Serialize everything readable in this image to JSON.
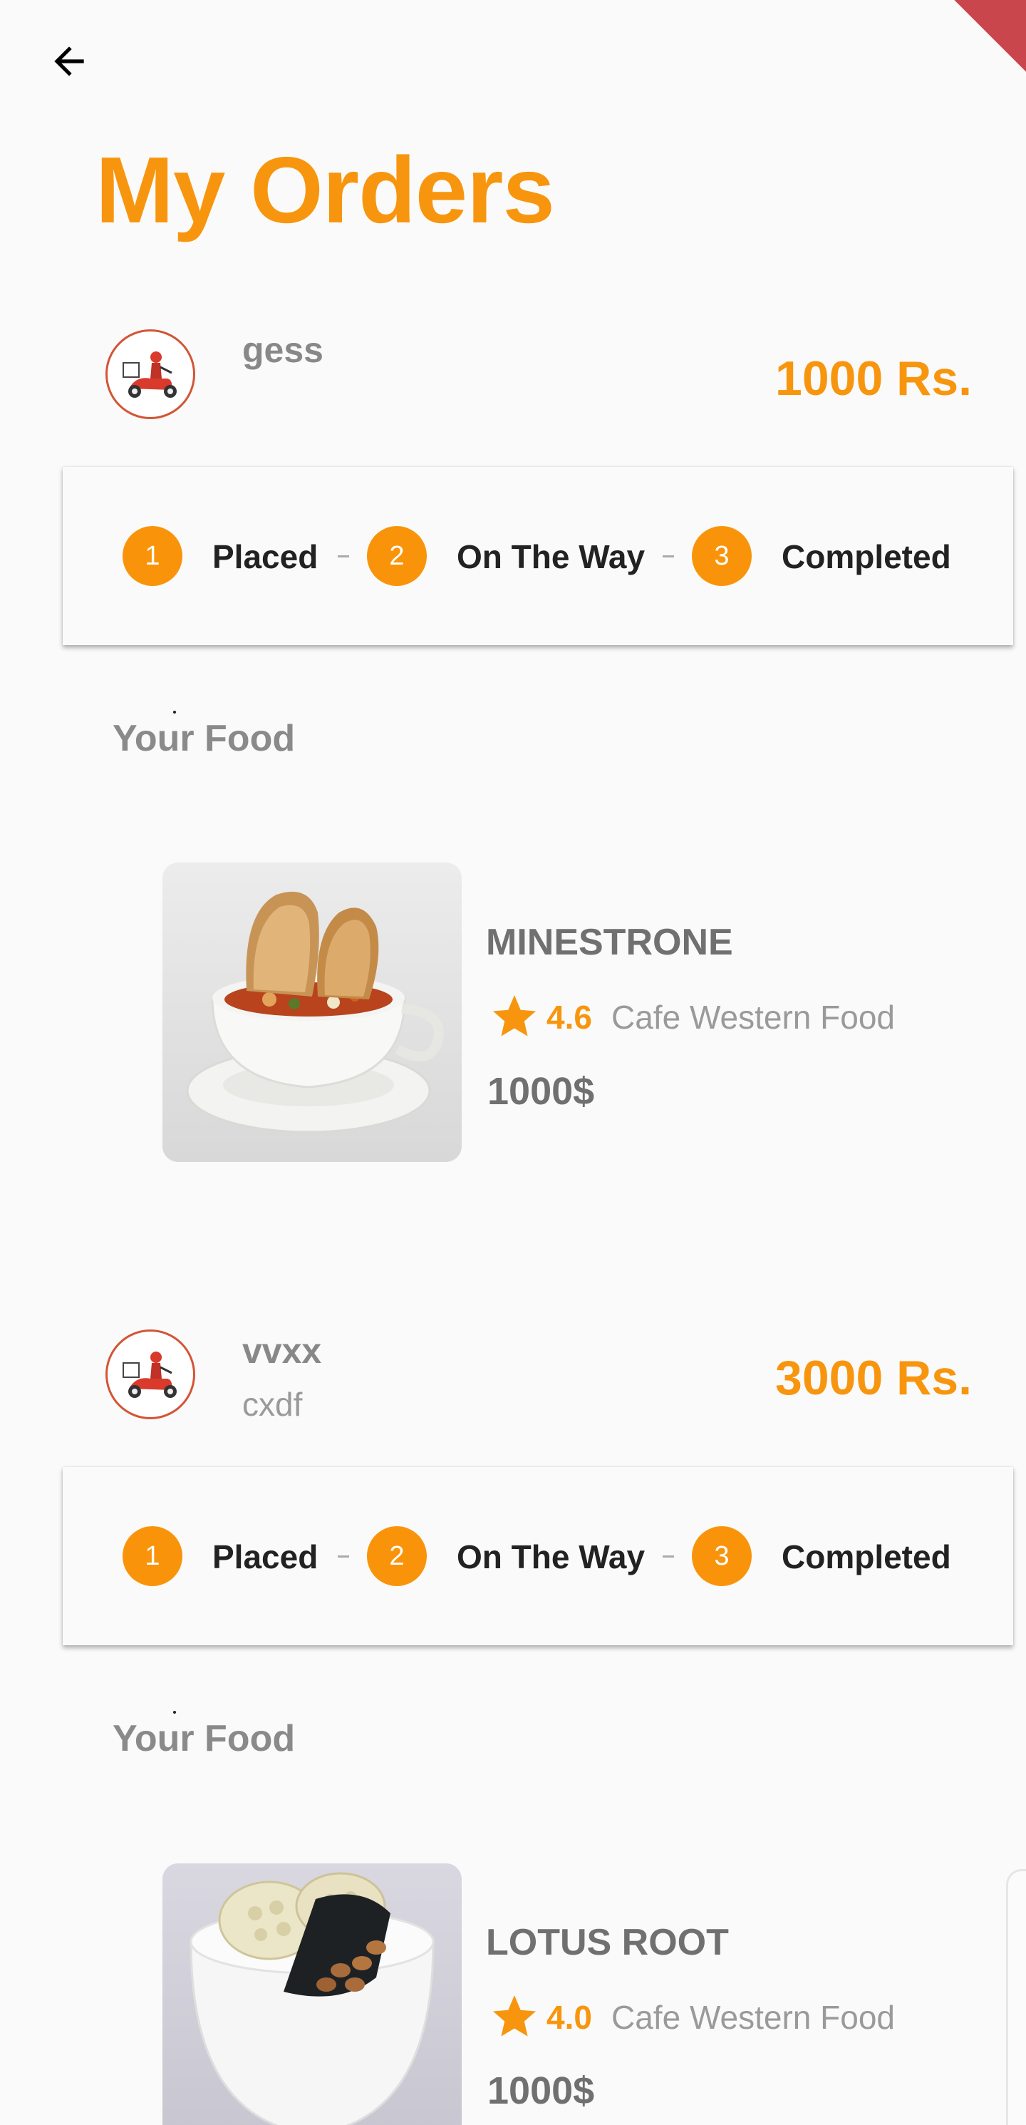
{
  "header": {
    "title": "My Orders",
    "back_icon": "arrow-left-icon"
  },
  "orders": [
    {
      "name": "gess",
      "subtitle": "",
      "total": "1000 Rs.",
      "avatar_icon": "delivery-scooter-icon",
      "steps": [
        {
          "number": "1",
          "label": "Placed"
        },
        {
          "number": "2",
          "label": "On The Way"
        },
        {
          "number": "3",
          "label": "Completed"
        }
      ],
      "section_title": "Your Food",
      "food": {
        "name": "MINESTRONE",
        "rating": "4.6",
        "category": "Cafe Western Food",
        "price": "1000$",
        "image_icon": "soup-bowl-icon"
      }
    },
    {
      "name": "vvxx",
      "subtitle": "cxdf",
      "total": "3000 Rs.",
      "avatar_icon": "delivery-scooter-icon",
      "steps": [
        {
          "number": "1",
          "label": "Placed"
        },
        {
          "number": "2",
          "label": "On The Way"
        },
        {
          "number": "3",
          "label": "Completed"
        }
      ],
      "section_title": "Your Food",
      "food": {
        "name": "LOTUS ROOT",
        "rating": "4.0",
        "category": "Cafe Western Food",
        "price": "1000$",
        "image_icon": "soup-bowl-icon"
      }
    }
  ],
  "colors": {
    "accent": "#f7960e",
    "step_circle": "#f9940a",
    "avatar_border": "#d35536",
    "background": "#fafafa",
    "debug_banner": "#c8464c"
  }
}
